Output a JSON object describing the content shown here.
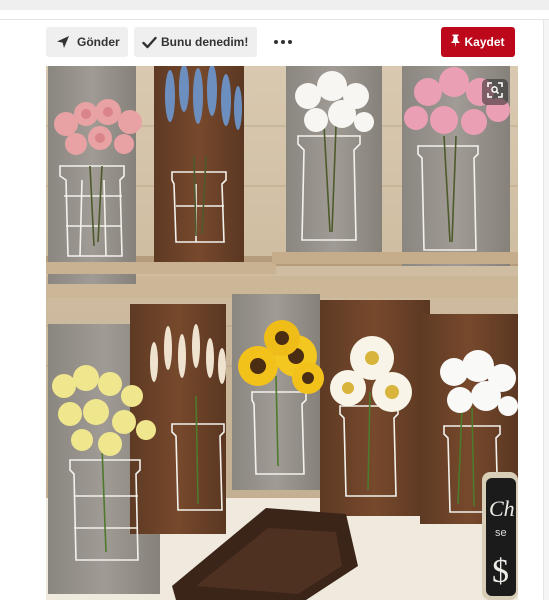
{
  "toolbar": {
    "send_label": "Gönder",
    "send_icon": "paper-plane-icon",
    "tried_label": "Bunu denedim!",
    "tried_icon": "checkmark-icon",
    "more_icon": "more-dots-icon",
    "save_label": "Kaydet",
    "save_icon": "pushpin-icon"
  },
  "image": {
    "lens_icon": "visual-search-icon",
    "sign_text": "Ch",
    "sign_text_2": "se",
    "sign_text_3": "$"
  },
  "colors": {
    "save_red": "#bd081c",
    "button_gray": "#efefef",
    "text_dark": "#333333"
  }
}
